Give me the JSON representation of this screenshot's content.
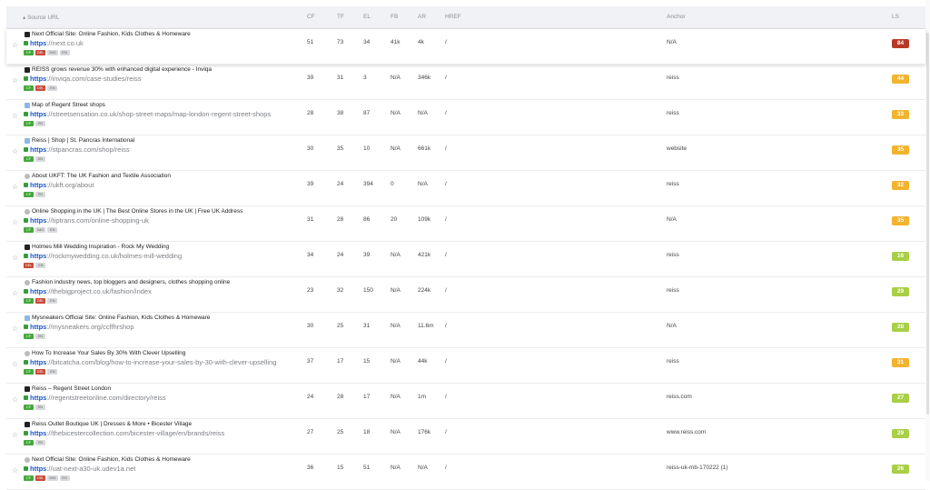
{
  "header": {
    "source_url": "▴ Source URL",
    "cf": "CF",
    "tf": "TF",
    "el": "EL",
    "fb": "FB",
    "ar": "AR",
    "href": "HREF",
    "anchor": "Anchor",
    "ls": "LS"
  },
  "rows": [
    {
      "title": "Next Official Site: Online Fashion, Kids Clothes & Homeware",
      "proto": "https",
      "rest": "://next.co.uk",
      "tags": [
        "CF",
        "DEL",
        "IMG",
        "EN"
      ],
      "cf": "51",
      "tf": "73",
      "el": "34",
      "fb": "41k",
      "ar": "4k",
      "href": "/",
      "anchor": "N/A",
      "ls": "84",
      "ls_color": "#b83a26",
      "fav": "dark"
    },
    {
      "title": "REISS grows revenue 30% with enhanced digital experience  - Inviqa",
      "proto": "https",
      "rest": "://inviqa.com/case-studies/reiss",
      "tags": [
        "CF",
        "DEL",
        "EN"
      ],
      "cf": "39",
      "tf": "31",
      "el": "3",
      "fb": "N/A",
      "ar": "346k",
      "href": "/",
      "anchor": "reiss",
      "ls": "44",
      "ls_color": "#f2b32e",
      "fav": "dark"
    },
    {
      "title": "Map of Regent Street shops",
      "proto": "https",
      "rest": "://streetsensation.co.uk/shop-street-maps/map-london-regent-street-shops",
      "tags": [
        "CF",
        "EN"
      ],
      "cf": "28",
      "tf": "38",
      "el": "87",
      "fb": "N/A",
      "ar": "N/A",
      "href": "/",
      "anchor": "reiss",
      "ls": "33",
      "ls_color": "#f2b32e",
      "fav": "blue"
    },
    {
      "title": "Reiss | Shop | St. Pancras International",
      "proto": "https",
      "rest": "://stpancras.com/shop/reiss",
      "tags": [
        "CF",
        "EN"
      ],
      "cf": "30",
      "tf": "35",
      "el": "10",
      "fb": "N/A",
      "ar": "661k",
      "href": "/",
      "anchor": "website",
      "ls": "35",
      "ls_color": "#f2b32e",
      "fav": "blue"
    },
    {
      "title": "About UKFT: The UK Fashion and Textile Association",
      "proto": "https",
      "rest": "://ukft.org/about",
      "tags": [
        "CF",
        "EN"
      ],
      "cf": "39",
      "tf": "24",
      "el": "394",
      "fb": "0",
      "ar": "N/A",
      "href": "/",
      "anchor": "reiss",
      "ls": "32",
      "ls_color": "#f2b32e",
      "fav": "grey"
    },
    {
      "title": "Online Shopping in the UK | The Best Online Stores in the UK | Free UK Address",
      "proto": "https",
      "rest": "://tiptrans.com/online-shopping-uk",
      "tags": [
        "CF",
        "IMG",
        "EN"
      ],
      "cf": "31",
      "tf": "28",
      "el": "86",
      "fb": "20",
      "ar": "109k",
      "href": "/",
      "anchor": "N/A",
      "ls": "35",
      "ls_color": "#f2b32e",
      "fav": "grey"
    },
    {
      "title": "Holmes Mill Wedding Inspiration - Rock My Wedding",
      "proto": "https",
      "rest": "://rockmywedding.co.uk/holmes-mill-wedding",
      "tags": [
        "DEL",
        "EN"
      ],
      "cf": "34",
      "tf": "24",
      "el": "39",
      "fb": "N/A",
      "ar": "421k",
      "href": "/",
      "anchor": "reiss",
      "ls": "16",
      "ls_color": "#a8cf45",
      "fav": "dark"
    },
    {
      "title": "Fashion industry news, top bloggers and designers, clothes shopping online",
      "proto": "https",
      "rest": "://thebigproject.co.uk/fashion/index",
      "tags": [
        "CF",
        "DEL",
        "EN"
      ],
      "cf": "23",
      "tf": "32",
      "el": "150",
      "fb": "N/A",
      "ar": "224k",
      "href": "/",
      "anchor": "reiss",
      "ls": "29",
      "ls_color": "#a8cf45",
      "fav": "grey"
    },
    {
      "title": "Mysneakers Official Site: Online Fashion, Kids Clothes & Homeware",
      "proto": "https",
      "rest": "://mysneakers.org/ccffhrshop",
      "tags": [
        "CF",
        "EN"
      ],
      "cf": "30",
      "tf": "25",
      "el": "31",
      "fb": "N/A",
      "ar": "11.6m",
      "href": "/",
      "anchor": "N/A",
      "ls": "28",
      "ls_color": "#a8cf45",
      "fav": "blue"
    },
    {
      "title": "How To Increase Your Sales By 30% With Clever Upselling",
      "proto": "https",
      "rest": "://bitcatcha.com/blog/how-to-increase-your-sales-by-30-with-clever-upselling",
      "tags": [
        "CF",
        "DEL",
        "EN"
      ],
      "cf": "37",
      "tf": "17",
      "el": "15",
      "fb": "N/A",
      "ar": "44k",
      "href": "/",
      "anchor": "reiss",
      "ls": "31",
      "ls_color": "#f2b32e",
      "fav": "grey"
    },
    {
      "title": "Reiss – Regent Street London",
      "proto": "https",
      "rest": "://regentstreetonline.com/directory/reiss",
      "tags": [
        "CF",
        "EN"
      ],
      "cf": "24",
      "tf": "28",
      "el": "17",
      "fb": "N/A",
      "ar": "1m",
      "href": "/",
      "anchor": "reiss.com",
      "ls": "27",
      "ls_color": "#a8cf45",
      "fav": "dark"
    },
    {
      "title": "Reiss Outlet Boutique UK | Dresses & More • Bicester Village",
      "proto": "https",
      "rest": "://thebicestercollection.com/bicester-village/en/brands/reiss",
      "tags": [
        "CF",
        "EN"
      ],
      "cf": "27",
      "tf": "25",
      "el": "18",
      "fb": "N/A",
      "ar": "176k",
      "href": "/",
      "anchor": "www.reiss.com",
      "ls": "29",
      "ls_color": "#a8cf45",
      "fav": "dark"
    },
    {
      "title": "Next Official Site: Online Fashion, Kids Clothes & Homeware",
      "proto": "https",
      "rest": "://uat-next-a30-uk.udev1a.net",
      "tags": [
        "CF",
        "DEL",
        "IMG",
        "EN"
      ],
      "cf": "36",
      "tf": "15",
      "el": "51",
      "fb": "N/A",
      "ar": "N/A",
      "href": "/",
      "anchor": "reiss-uk-mb-170222 (1)",
      "ls": "26",
      "ls_color": "#a8cf45",
      "fav": "grey"
    }
  ]
}
